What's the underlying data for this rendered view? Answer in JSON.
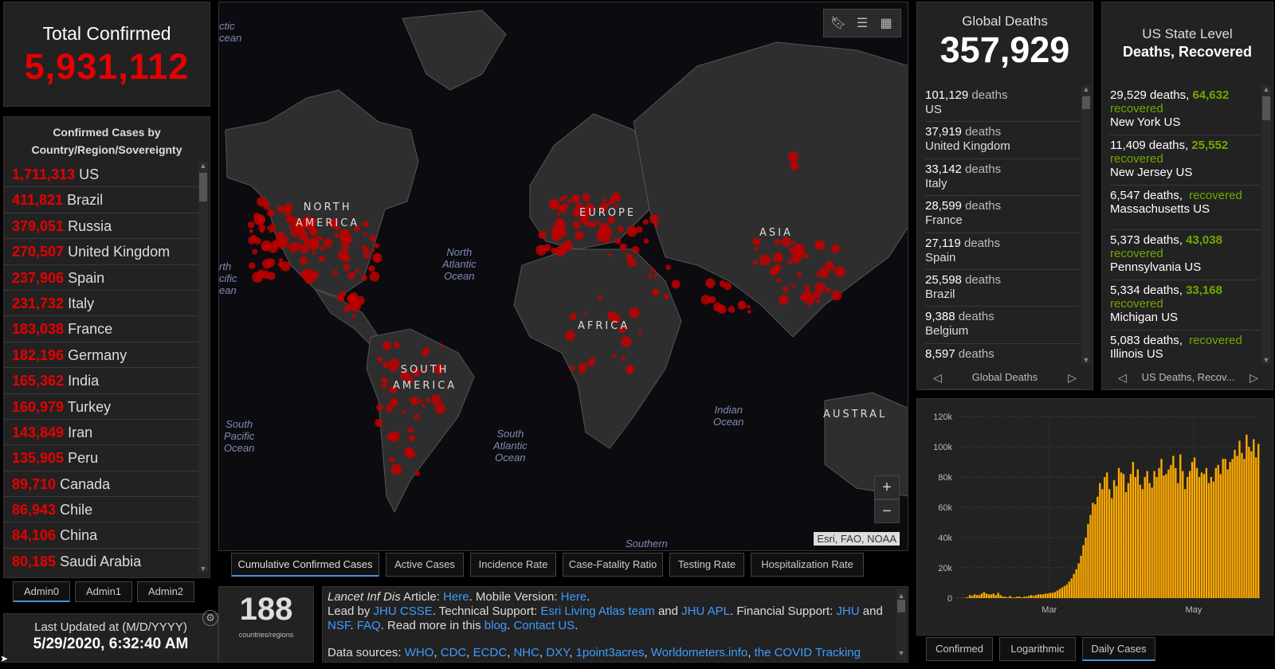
{
  "total": {
    "label": "Total Confirmed",
    "value": "5,931,112"
  },
  "countries": {
    "header_line1": "Confirmed Cases by",
    "header_line2": "Country/Region/Sovereignty",
    "items": [
      {
        "value": "1,711,313",
        "name": "US"
      },
      {
        "value": "411,821",
        "name": "Brazil"
      },
      {
        "value": "379,051",
        "name": "Russia"
      },
      {
        "value": "270,507",
        "name": "United Kingdom"
      },
      {
        "value": "237,906",
        "name": "Spain"
      },
      {
        "value": "231,732",
        "name": "Italy"
      },
      {
        "value": "183,038",
        "name": "France"
      },
      {
        "value": "182,196",
        "name": "Germany"
      },
      {
        "value": "165,362",
        "name": "India"
      },
      {
        "value": "160,979",
        "name": "Turkey"
      },
      {
        "value": "143,849",
        "name": "Iran"
      },
      {
        "value": "135,905",
        "name": "Peru"
      },
      {
        "value": "89,710",
        "name": "Canada"
      },
      {
        "value": "86,943",
        "name": "Chile"
      },
      {
        "value": "84,106",
        "name": "China"
      },
      {
        "value": "80,185",
        "name": "Saudi Arabia"
      }
    ]
  },
  "admin_tabs": [
    "Admin0",
    "Admin1",
    "Admin2"
  ],
  "updated": {
    "label": "Last Updated at (M/D/YYYY)",
    "value": "5/29/2020, 6:32:40 AM"
  },
  "map": {
    "continents": {
      "north_america_1": "NORTH",
      "north_america_2": "AMERICA",
      "europe": "EUROPE",
      "asia": "ASIA",
      "africa": "AFRICA",
      "south_america_1": "SOUTH",
      "south_america_2": "AMERICA",
      "australia": "AUSTRAL"
    },
    "oceans": {
      "arctic_1": "ctic",
      "arctic_2": "cean",
      "north_pacific_1": "rth",
      "north_pacific_2": "cific",
      "north_pacific_3": "ean",
      "north_atlantic_1": "North",
      "north_atlantic_2": "Atlantic",
      "north_atlantic_3": "Ocean",
      "south_pacific_1": "South",
      "south_pacific_2": "Pacific",
      "south_pacific_3": "Ocean",
      "south_atlantic_1": "South",
      "south_atlantic_2": "Atlantic",
      "south_atlantic_3": "Ocean",
      "indian_1": "Indian",
      "indian_2": "Ocean",
      "southern": "Southern"
    },
    "attribution": "Esri, FAO, NOAA",
    "zoom_in": "+",
    "zoom_out": "−"
  },
  "map_tabs": [
    "Cumulative Confirmed Cases",
    "Active Cases",
    "Incidence Rate",
    "Case-Fatality Ratio",
    "Testing Rate",
    "Hospitalization Rate"
  ],
  "countries_count": {
    "value": "188",
    "label": "countries/regions"
  },
  "info": {
    "l1_a": "Lancet Inf Dis",
    "l1_b": " Article: ",
    "l1_link1": "Here",
    "l1_c": ". Mobile Version: ",
    "l1_link2": "Here",
    "l1_d": ".",
    "l2_a": "Lead by ",
    "l2_link1": "JHU CSSE",
    "l2_b": ". Technical Support: ",
    "l2_link2": "Esri Living Atlas team",
    "l2_c": " and ",
    "l2_link3": "JHU APL",
    "l2_d": ". Financial Support: ",
    "l2_link4": "JHU",
    "l2_e": " and",
    "l3_link1": "NSF",
    "l3_a": ". ",
    "l3_link2": "FAQ",
    "l3_b": ". Read more in this ",
    "l3_link3": "blog",
    "l3_c": ". ",
    "l3_link4": "Contact US",
    "l3_d": ".",
    "l4_a": "Data sources: ",
    "l4_links": [
      "WHO",
      "CDC",
      "ECDC",
      "NHC",
      "DXY",
      "1point3acres",
      "Worldometers.info",
      "the COVID Tracking"
    ]
  },
  "global_deaths": {
    "label": "Global Deaths",
    "value": "357,929",
    "word": "deaths",
    "items": [
      {
        "value": "101,129",
        "name": "US"
      },
      {
        "value": "37,919",
        "name": "United Kingdom"
      },
      {
        "value": "33,142",
        "name": "Italy"
      },
      {
        "value": "28,599",
        "name": "France"
      },
      {
        "value": "27,119",
        "name": "Spain"
      },
      {
        "value": "25,598",
        "name": "Brazil"
      },
      {
        "value": "9,388",
        "name": "Belgium"
      },
      {
        "value": "8,597",
        "name": ""
      }
    ],
    "pager_label": "Global Deaths"
  },
  "us_state": {
    "label1": "US State Level",
    "label2": "Deaths, Recovered",
    "items": [
      {
        "deaths": "29,529 deaths, ",
        "recovered": "64,632",
        "rec_word": "recovered",
        "name": "New York US"
      },
      {
        "deaths": "11,409 deaths, ",
        "recovered": "25,552",
        "rec_word": "recovered",
        "name": "New Jersey US"
      },
      {
        "deaths": "6,547 deaths, ",
        "recovered": "",
        "rec_word": "recovered",
        "name": "Massachusetts US"
      },
      {
        "deaths": "5,373 deaths, ",
        "recovered": "43,038",
        "rec_word": "recovered",
        "name": "Pennsylvania US"
      },
      {
        "deaths": "5,334 deaths, ",
        "recovered": "33,168",
        "rec_word": "recovered",
        "name": "Michigan US"
      },
      {
        "deaths": "5,083 deaths, ",
        "recovered": "",
        "rec_word": "recovered",
        "name": "Illinois US"
      }
    ],
    "pager_label": "US Deaths, Recov..."
  },
  "chart_tabs": [
    "Confirmed",
    "Logarithmic",
    "Daily Cases"
  ],
  "colors": {
    "confirmed_red": "#e60000",
    "recovered_green": "#70a800",
    "bar_orange": "#ffaa00",
    "link_blue": "#3d9cff"
  },
  "chart_data": {
    "type": "bar",
    "title": "",
    "xlabel": "",
    "ylabel": "",
    "ylim": [
      0,
      120000
    ],
    "yticks": [
      "0",
      "20k",
      "40k",
      "60k",
      "80k",
      "100k",
      "120k"
    ],
    "xticks": [
      {
        "label": "Mar",
        "index": 39
      },
      {
        "label": "May",
        "index": 100
      }
    ],
    "values": [
      100,
      0,
      100,
      200,
      500,
      2000,
      1500,
      2500,
      2000,
      2000,
      3000,
      4000,
      3000,
      2500,
      2500,
      3000,
      2000,
      3500,
      2000,
      1000,
      1000,
      500,
      1500,
      500,
      500,
      1000,
      1000,
      500,
      1000,
      1000,
      1500,
      2000,
      1500,
      2000,
      2500,
      2500,
      2500,
      3000,
      3000,
      3500,
      3500,
      4000,
      5000,
      6000,
      7000,
      8000,
      9000,
      11000,
      13000,
      16000,
      19000,
      23000,
      28000,
      35000,
      40000,
      49000,
      55000,
      63000,
      62000,
      67000,
      76000,
      72000,
      80000,
      83000,
      72000,
      66000,
      78000,
      74000,
      86000,
      83000,
      82000,
      70000,
      76000,
      82000,
      90000,
      80000,
      85000,
      75000,
      72000,
      80000,
      84000,
      76000,
      73000,
      84000,
      80000,
      86000,
      92000,
      81000,
      82000,
      85000,
      88000,
      94000,
      86000,
      76000,
      95000,
      84000,
      72000,
      80000,
      84000,
      90000,
      93000,
      86000,
      80000,
      83000,
      82000,
      86000,
      76000,
      80000,
      77000,
      86000,
      88000,
      82000,
      92000,
      92000,
      85000,
      90000,
      92000,
      98000,
      94000,
      104000,
      96000,
      92000,
      108000,
      100000,
      97000,
      105000,
      93000,
      102000
    ]
  }
}
